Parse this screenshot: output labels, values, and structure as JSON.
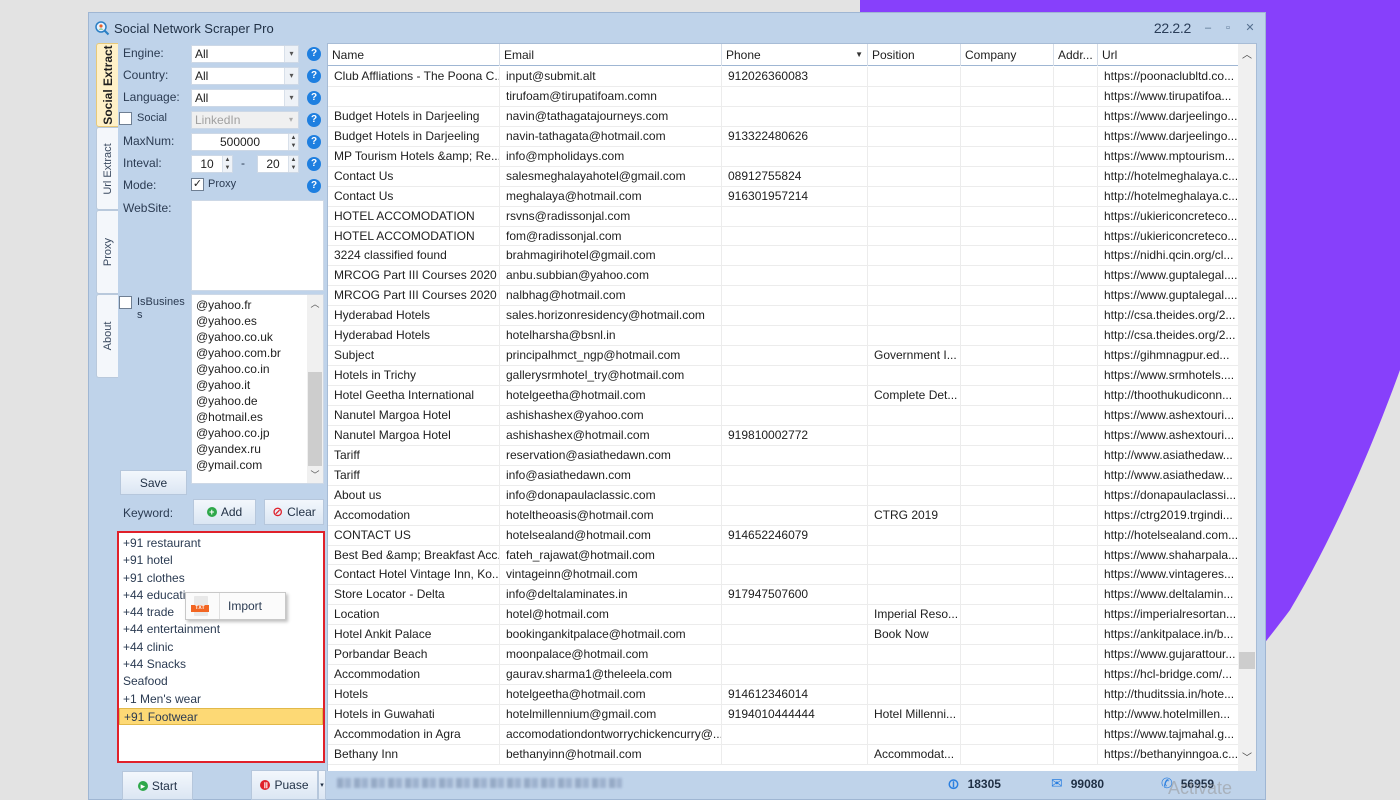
{
  "window": {
    "title": "Social Network Scraper Pro",
    "version": "22.2.2",
    "controls": {
      "minimize": "–",
      "maximize": "▫",
      "close": "✕"
    }
  },
  "side_tabs": [
    {
      "label": "Social Extract",
      "active": true
    },
    {
      "label": "Url Extract",
      "active": false
    },
    {
      "label": "Proxy",
      "active": false
    },
    {
      "label": "About",
      "active": false
    }
  ],
  "form": {
    "engine": {
      "label": "Engine:",
      "value": "All"
    },
    "country": {
      "label": "Country:",
      "value": "All"
    },
    "language": {
      "label": "Language:",
      "value": "All"
    },
    "social": {
      "label": "Social",
      "checked": false,
      "value": "LinkedIn"
    },
    "maxnum": {
      "label": "MaxNum:",
      "value": "500000"
    },
    "interval": {
      "label": "Inteval:",
      "from": "10",
      "separator": "-",
      "to": "20"
    },
    "mode": {
      "label": "Mode:",
      "proxy_label": "Proxy",
      "proxy_checked": true
    },
    "website": {
      "label": "WebSite:",
      "value": ""
    },
    "is_business": {
      "label": "IsBusines s",
      "checked": false
    },
    "domains": [
      "@yahoo.fr",
      "@yahoo.es",
      "@yahoo.co.uk",
      "@yahoo.com.br",
      "@yahoo.co.in",
      "@yahoo.it",
      "@yahoo.de",
      "@hotmail.es",
      "@yahoo.co.jp",
      "@yandex.ru",
      "@ymail.com"
    ],
    "save_label": "Save",
    "keyword_label": "Keyword:",
    "add_label": "Add",
    "clear_label": "Clear",
    "help_glyph": "?",
    "keywords": [
      "+91 restaurant",
      "+91 hotel",
      "+91 clothes",
      "+44 education",
      "+44 trade",
      "+44 entertainment",
      "+44 clinic",
      "+44 Snacks",
      "Seafood",
      "+1 Men's wear",
      "+91 Footwear"
    ],
    "selected_keyword": "+91 Footwear",
    "context_menu": {
      "item": "Import",
      "icon_tag": "TXT"
    },
    "start_label": "Start",
    "pause_label": "Puase"
  },
  "grid": {
    "columns": [
      "Name",
      "Email",
      "Phone",
      "Position",
      "Company",
      "Addr...",
      "Url"
    ],
    "sorted_column": "Phone",
    "rows": [
      [
        "Club Affliations - The Poona C...",
        "input@submit.alt",
        "912026360083",
        "",
        "",
        "",
        "https://poonaclubltd.co..."
      ],
      [
        "",
        "tirufoam@tirupatifoam.comn",
        "",
        "",
        "",
        "",
        "https://www.tirupatifoa..."
      ],
      [
        "Budget Hotels in Darjeeling",
        "navin@tathagatajourneys.com",
        "",
        "",
        "",
        "",
        "https://www.darjeelingo..."
      ],
      [
        "Budget Hotels in Darjeeling",
        "navin-tathagata@hotmail.com",
        "913322480626",
        "",
        "",
        "",
        "https://www.darjeelingo..."
      ],
      [
        "MP Tourism Hotels &amp; Re...",
        "info@mpholidays.com",
        "",
        "",
        "",
        "",
        "https://www.mptourism..."
      ],
      [
        "Contact Us",
        "salesmeghalayahotel@gmail.com",
        "08912755824",
        "",
        "",
        "",
        "http://hotelmeghalaya.c..."
      ],
      [
        "Contact Us",
        "meghalaya@hotmail.com",
        "916301957214",
        "",
        "",
        "",
        "http://hotelmeghalaya.c..."
      ],
      [
        "HOTEL ACCOMODATION",
        "rsvns@radissonjal.com",
        "",
        "",
        "",
        "",
        "https://ukiericoncreteco..."
      ],
      [
        "HOTEL ACCOMODATION",
        "fom@radissonjal.com",
        "",
        "",
        "",
        "",
        "https://ukiericoncreteco..."
      ],
      [
        "3224 classified found",
        "brahmagirihotel@gmail.com",
        "",
        "",
        "",
        "",
        "https://nidhi.qcin.org/cl..."
      ],
      [
        "MRCOG Part III Courses 2020",
        "anbu.subbian@yahoo.com",
        "",
        "",
        "",
        "",
        "https://www.guptalegal...."
      ],
      [
        "MRCOG Part III Courses 2020",
        "nalbhag@hotmail.com",
        "",
        "",
        "",
        "",
        "https://www.guptalegal...."
      ],
      [
        "Hyderabad Hotels",
        "sales.horizonresidency@hotmail.com",
        "",
        "",
        "",
        "",
        "http://csa.theides.org/2..."
      ],
      [
        "Hyderabad Hotels",
        "hotelharsha@bsnl.in",
        "",
        "",
        "",
        "",
        "http://csa.theides.org/2..."
      ],
      [
        "Subject",
        "principalhmct_ngp@hotmail.com",
        "",
        "Government I...",
        "",
        "",
        "https://gihmnagpur.ed..."
      ],
      [
        "Hotels in Trichy",
        "gallerysrmhotel_try@hotmail.com",
        "",
        "",
        "",
        "",
        "https://www.srmhotels...."
      ],
      [
        "Hotel Geetha International",
        "hotelgeetha@hotmail.com",
        "",
        "Complete Det...",
        "",
        "",
        "http://thoothukudiconn..."
      ],
      [
        "Nanutel Margoa Hotel",
        "ashishashex@yahoo.com",
        "",
        "",
        "",
        "",
        "https://www.ashextouri..."
      ],
      [
        "Nanutel Margoa Hotel",
        "ashishashex@hotmail.com",
        "919810002772",
        "",
        "",
        "",
        "https://www.ashextouri..."
      ],
      [
        "Tariff",
        "reservation@asiathedawn.com",
        "",
        "",
        "",
        "",
        "http://www.asiathedaw..."
      ],
      [
        "Tariff",
        "info@asiathedawn.com",
        "",
        "",
        "",
        "",
        "http://www.asiathedaw..."
      ],
      [
        "About us",
        "info@donapaulaclassic.com",
        "",
        "",
        "",
        "",
        "https://donapaulaclassi..."
      ],
      [
        "Accomodation",
        "hoteltheoasis@hotmail.com",
        "",
        "CTRG 2019",
        "",
        "",
        "https://ctrg2019.trgindi..."
      ],
      [
        "CONTACT US",
        "hotelsealand@hotmail.com",
        "914652246079",
        "",
        "",
        "",
        "http://hotelsealand.com..."
      ],
      [
        "Best Bed &amp; Breakfast Acc...",
        "fateh_rajawat@hotmail.com",
        "",
        "",
        "",
        "",
        "https://www.shaharpala..."
      ],
      [
        "Contact Hotel Vintage Inn, Ko...",
        "vintageinn@hotmail.com",
        "",
        "",
        "",
        "",
        "https://www.vintageres..."
      ],
      [
        "Store Locator - Delta",
        "info@deltalaminates.in",
        "917947507600",
        "",
        "",
        "",
        "https://www.deltalamin..."
      ],
      [
        "Location",
        "hotel@hotmail.com",
        "",
        "Imperial Reso...",
        "",
        "",
        "https://imperialresortan..."
      ],
      [
        "Hotel Ankit Palace",
        "bookingankitpalace@hotmail.com",
        "",
        "Book Now",
        "",
        "",
        "https://ankitpalace.in/b..."
      ],
      [
        "Porbandar Beach",
        "moonpalace@hotmail.com",
        "",
        "",
        "",
        "",
        "https://www.gujarattour..."
      ],
      [
        "Accommodation",
        "gaurav.sharma1@theleela.com",
        "",
        "",
        "",
        "",
        "https://hcl-bridge.com/..."
      ],
      [
        "Hotels",
        "hotelgeetha@hotmail.com",
        "914612346014",
        "",
        "",
        "",
        "http://thuditssia.in/hote..."
      ],
      [
        "Hotels in Guwahati",
        "hotelmillennium@gmail.com",
        "9194010444444",
        "Hotel Millenni...",
        "",
        "",
        "http://www.hotelmillen..."
      ],
      [
        "Accommodation in Agra",
        "accomodationdontworrychickencurry@...",
        "",
        "",
        "",
        "",
        "https://www.tajmahal.g..."
      ],
      [
        "Bethany Inn",
        "bethanyinn@hotmail.com",
        "",
        "Accommodat...",
        "",
        "",
        "https://bethanyinngoa.c..."
      ]
    ]
  },
  "status_bar": {
    "links_count": "18305",
    "emails_count": "99080",
    "phones_count": "56959"
  },
  "watermark": "Activate",
  "colors": {
    "accent_purple": "#8740fb",
    "window_bg": "#bfd3ea",
    "highlight_border": "#e0202a",
    "selected_row": "#fdd975"
  }
}
